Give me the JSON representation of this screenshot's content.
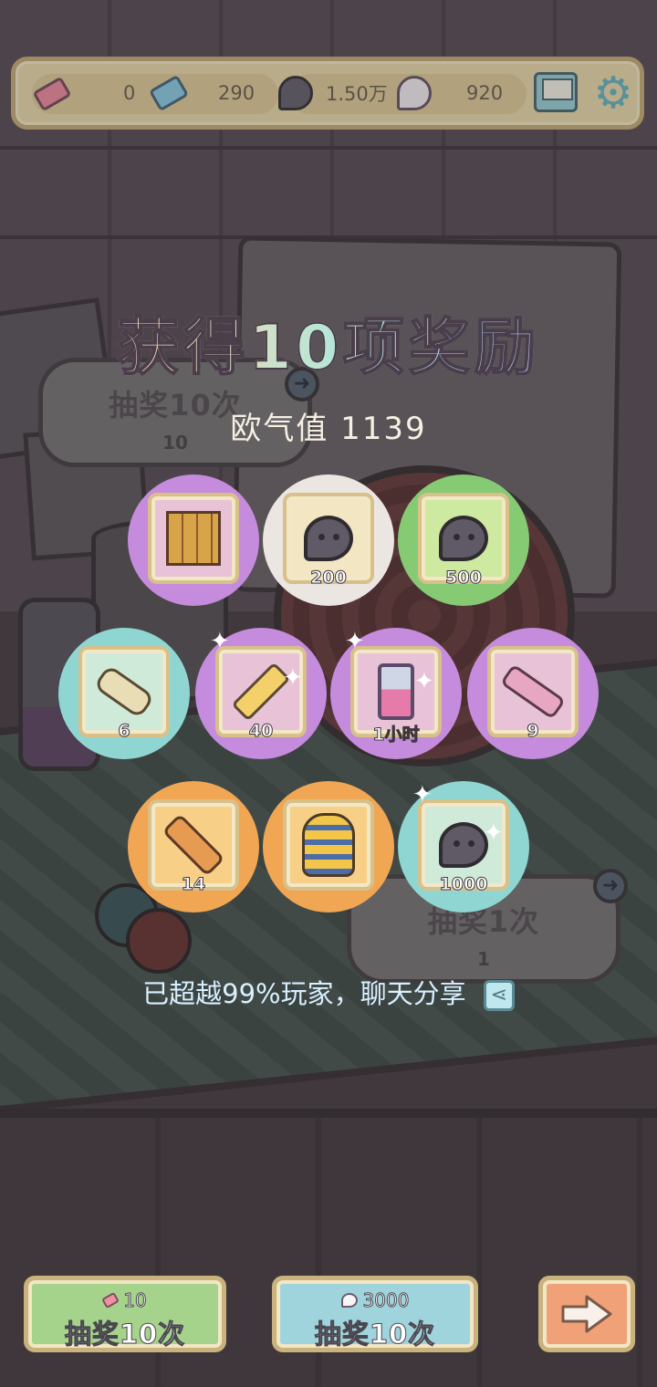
{
  "topbar": {
    "pink_ticket_count": "0",
    "blue_ticket_count": "290",
    "spirit_count": "1.50万",
    "white_spirit_count": "920"
  },
  "background": {
    "draw10_title": "抽奖10次",
    "draw10_cost": "10",
    "draw1_title": "抽奖1次",
    "draw1_cost": "1"
  },
  "panel": {
    "title": "获得10项奖励",
    "luck_label": "欧气值 1139",
    "rewards": [
      {
        "icon": "folding-screen-icon",
        "rarity": "purple",
        "qty": ""
      },
      {
        "icon": "spirit-icon",
        "rarity": "white",
        "qty": "200"
      },
      {
        "icon": "spirit-icon",
        "rarity": "green",
        "qty": "500"
      },
      {
        "icon": "scroll-icon",
        "rarity": "cyan",
        "qty": "6"
      },
      {
        "icon": "paint-tube-icon",
        "rarity": "purple",
        "qty": "40"
      },
      {
        "icon": "hourglass-icon",
        "rarity": "purple",
        "qty": "1小时"
      },
      {
        "icon": "telescope-icon",
        "rarity": "purple",
        "qty": "9"
      },
      {
        "icon": "telescope-icon",
        "rarity": "orange",
        "qty": "14"
      },
      {
        "icon": "pharaoh-mask-icon",
        "rarity": "orange",
        "qty": ""
      },
      {
        "icon": "spirit-icon",
        "rarity": "cyan",
        "qty": "1000"
      }
    ],
    "share_text": "已超越99%玩家，聊天分享"
  },
  "buttons": {
    "draw10_ticket_cost": "10",
    "draw10_ticket_label": "抽奖10次",
    "draw10_spirit_cost": "3000",
    "draw10_spirit_label": "抽奖10次"
  },
  "colors": {
    "purple": "#c58bdc",
    "white": "#ebe6e2",
    "green": "#86ca74",
    "cyan": "#8fd6d2",
    "orange": "#f0a653"
  }
}
